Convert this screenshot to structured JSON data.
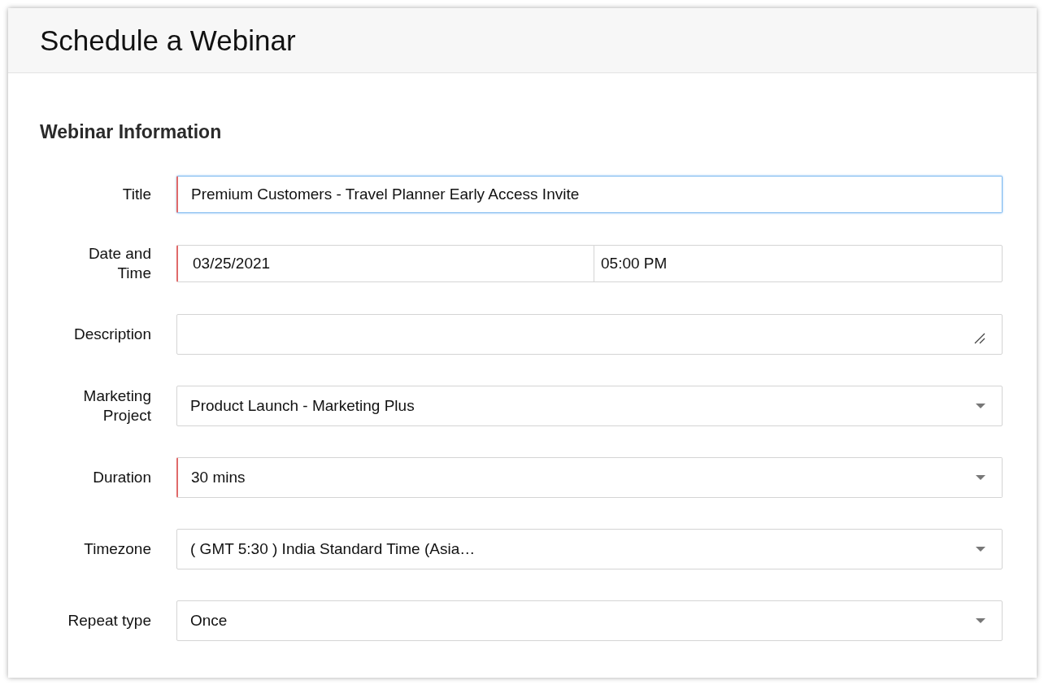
{
  "window": {
    "title": "Schedule a Webinar"
  },
  "section": {
    "heading": "Webinar Information"
  },
  "fields": [
    {
      "kind": "text",
      "label": "Title",
      "value": "Premium Customers - Travel Planner Early Access Invite",
      "required": true,
      "focused": true
    },
    {
      "kind": "datetime",
      "label": "Date and Time",
      "date": "03/25/2021",
      "time": "05:00 PM",
      "required": true,
      "focused": false
    },
    {
      "kind": "textarea",
      "label": "Description",
      "required": false,
      "focused": false
    },
    {
      "kind": "select",
      "label": "Marketing Project",
      "value": "Product Launch - Marketing Plus",
      "required": false,
      "focused": false
    },
    {
      "kind": "select",
      "label": "Duration",
      "value": "30 mins",
      "required": true,
      "focused": false
    },
    {
      "kind": "select",
      "label": "Timezone",
      "value": "( GMT 5:30 ) India Standard Time (Asia…",
      "required": false,
      "focused": false
    },
    {
      "kind": "select",
      "label": "Repeat type",
      "value": "Once",
      "required": false,
      "focused": false
    }
  ]
}
